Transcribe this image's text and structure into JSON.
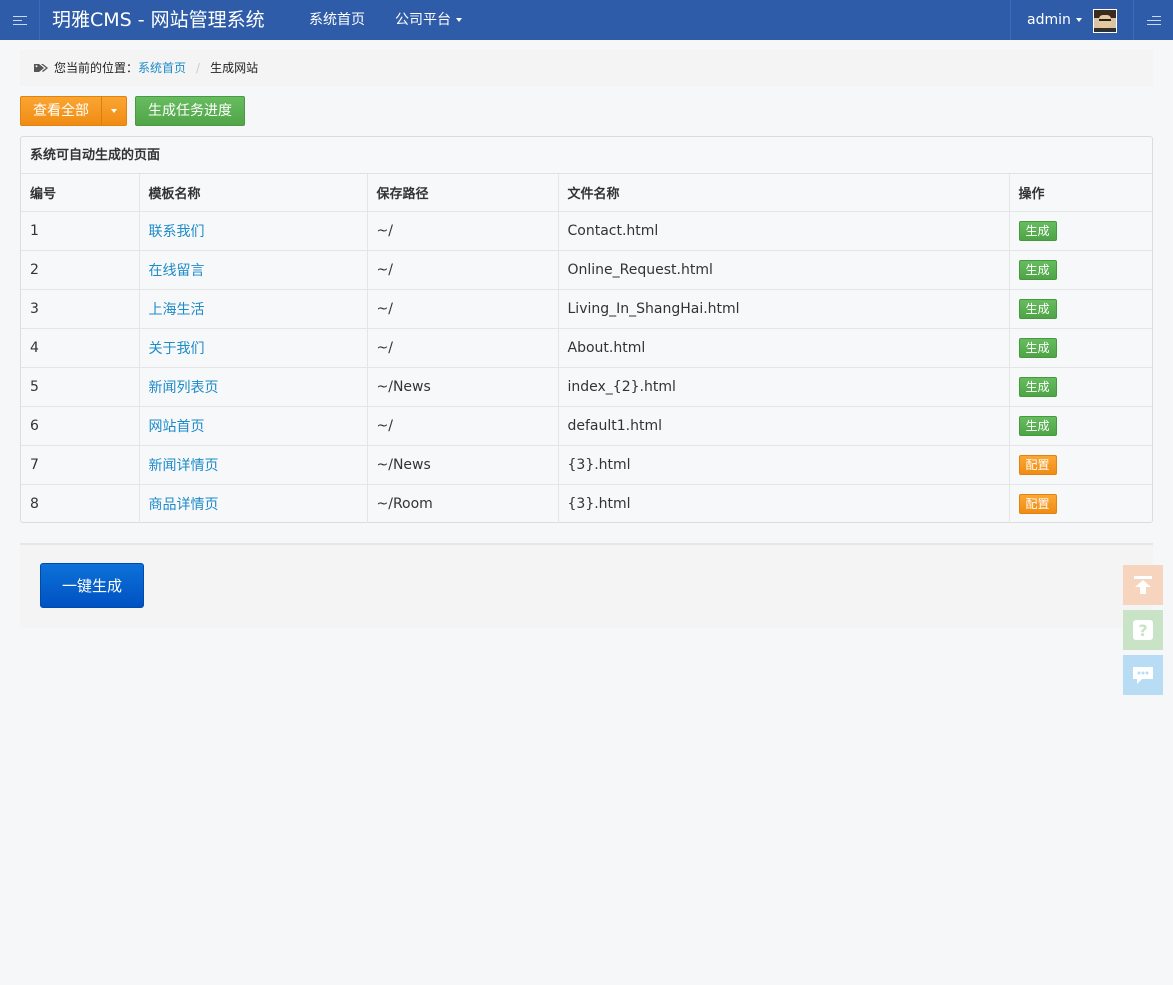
{
  "header": {
    "brand": "玥雅CMS - 网站管理系统",
    "nav_home": "系统首页",
    "nav_company": "公司平台",
    "user_name": "admin"
  },
  "breadcrumb": {
    "prefix": "您当前的位置：",
    "home": "系统首页",
    "separator": "/",
    "current": "生成网站"
  },
  "toolbar": {
    "view_all": "查看全部",
    "task_progress": "生成任务进度"
  },
  "panel": {
    "title": "系统可自动生成的页面",
    "columns": [
      "编号",
      "模板名称",
      "保存路径",
      "文件名称",
      "操作"
    ],
    "rows": [
      {
        "id": "1",
        "template": "联系我们",
        "path": "~/",
        "file": "Contact.html",
        "action": "生成",
        "action_type": "generate"
      },
      {
        "id": "2",
        "template": "在线留言",
        "path": "~/",
        "file": "Online_Request.html",
        "action": "生成",
        "action_type": "generate"
      },
      {
        "id": "3",
        "template": "上海生活",
        "path": "~/",
        "file": "Living_In_ShangHai.html",
        "action": "生成",
        "action_type": "generate"
      },
      {
        "id": "4",
        "template": "关于我们",
        "path": "~/",
        "file": "About.html",
        "action": "生成",
        "action_type": "generate"
      },
      {
        "id": "5",
        "template": "新闻列表页",
        "path": "~/News",
        "file": "index_{2}.html",
        "action": "生成",
        "action_type": "generate"
      },
      {
        "id": "6",
        "template": "网站首页",
        "path": "~/",
        "file": "default1.html",
        "action": "生成",
        "action_type": "generate"
      },
      {
        "id": "7",
        "template": "新闻详情页",
        "path": "~/News",
        "file": "{3}.html",
        "action": "配置",
        "action_type": "configure"
      },
      {
        "id": "8",
        "template": "商品详情页",
        "path": "~/Room",
        "file": "{3}.html",
        "action": "配置",
        "action_type": "configure"
      }
    ]
  },
  "footer": {
    "generate_all": "一键生成"
  },
  "icons": {
    "menu_left": "menu-icon",
    "menu_right": "menu-icon",
    "tag": "tags-icon",
    "back_to_top": "arrow-up-icon",
    "help": "question-icon",
    "chat": "chat-icon"
  },
  "colors": {
    "topbar": "#2e5ca9",
    "link": "#1d8bc8",
    "orange": "#f39a22",
    "green": "#5cb155",
    "blue": "#0b63cf"
  }
}
